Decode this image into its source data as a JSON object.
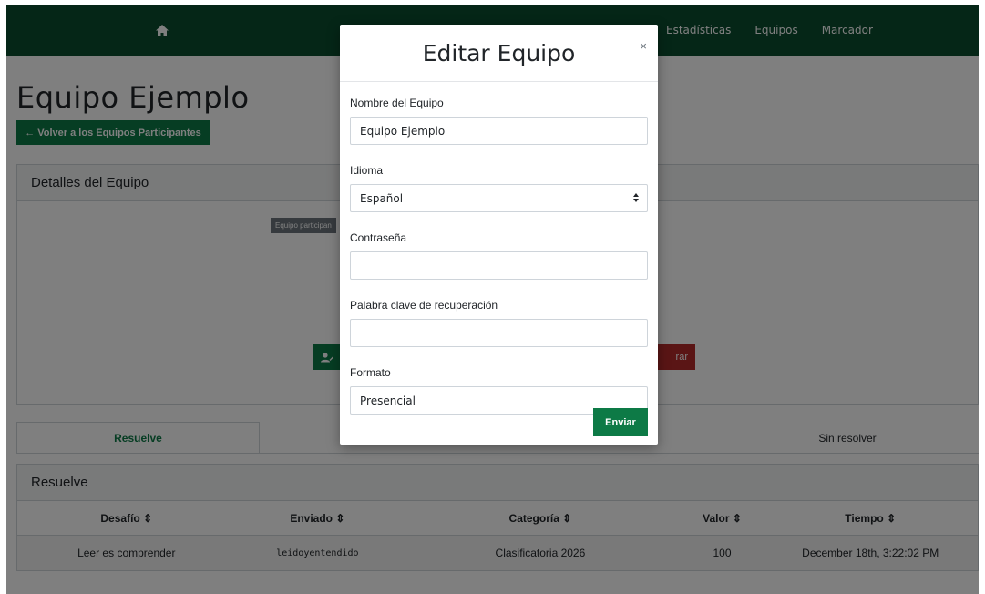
{
  "navbar": {
    "home_icon": "home-icon",
    "links": [
      "Estadísticas",
      "Equipos",
      "Marcador"
    ]
  },
  "page": {
    "team_name": "Equipo Ejemplo",
    "back_label": "← Volver a los Equipos Participantes",
    "details_header": "Detalles del Equipo",
    "participant_badge": "Equipo participan",
    "red_button_label": "rar"
  },
  "tabs": {
    "solves": "Resuelve",
    "unresolved": "Sin resolver"
  },
  "solves": {
    "header": "Resuelve",
    "columns": [
      "Desafío",
      "Enviado",
      "Categoría",
      "Valor",
      "Tiempo"
    ],
    "rows": [
      {
        "challenge": "Leer es comprender",
        "submitted": "leidoyentendido",
        "category": "Clasificatoria 2026",
        "value": "100",
        "time": "December 18th, 3:22:02 PM"
      }
    ]
  },
  "modal": {
    "title": "Editar Equipo",
    "close": "×",
    "name_label": "Nombre del Equipo",
    "name_value": "Equipo Ejemplo",
    "language_label": "Idioma",
    "language_value": "Español",
    "password_label": "Contraseña",
    "password_value": "",
    "recovery_label": "Palabra clave de recuperación",
    "recovery_value": "",
    "format_label": "Formato",
    "format_value": "Presencial",
    "submit_label": "Enviar"
  },
  "colors": {
    "navbar": "#0b4d2f",
    "primary": "#0d7a46",
    "danger": "#b52a2a"
  }
}
